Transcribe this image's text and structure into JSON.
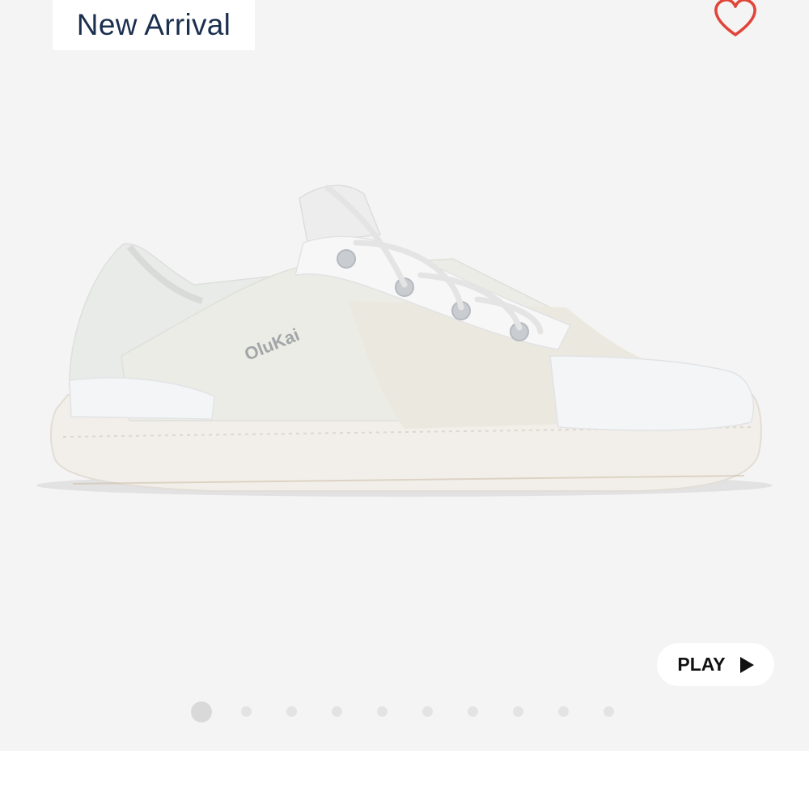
{
  "gallery": {
    "badge": "New Arrival",
    "favorite_icon": "heart-outline-icon",
    "favorite_color": "#e0453a",
    "product_logo_text": "OluKai",
    "play": {
      "label": "PLAY",
      "icon": "play-icon"
    },
    "pagination": {
      "total": 10,
      "current": 1
    }
  }
}
